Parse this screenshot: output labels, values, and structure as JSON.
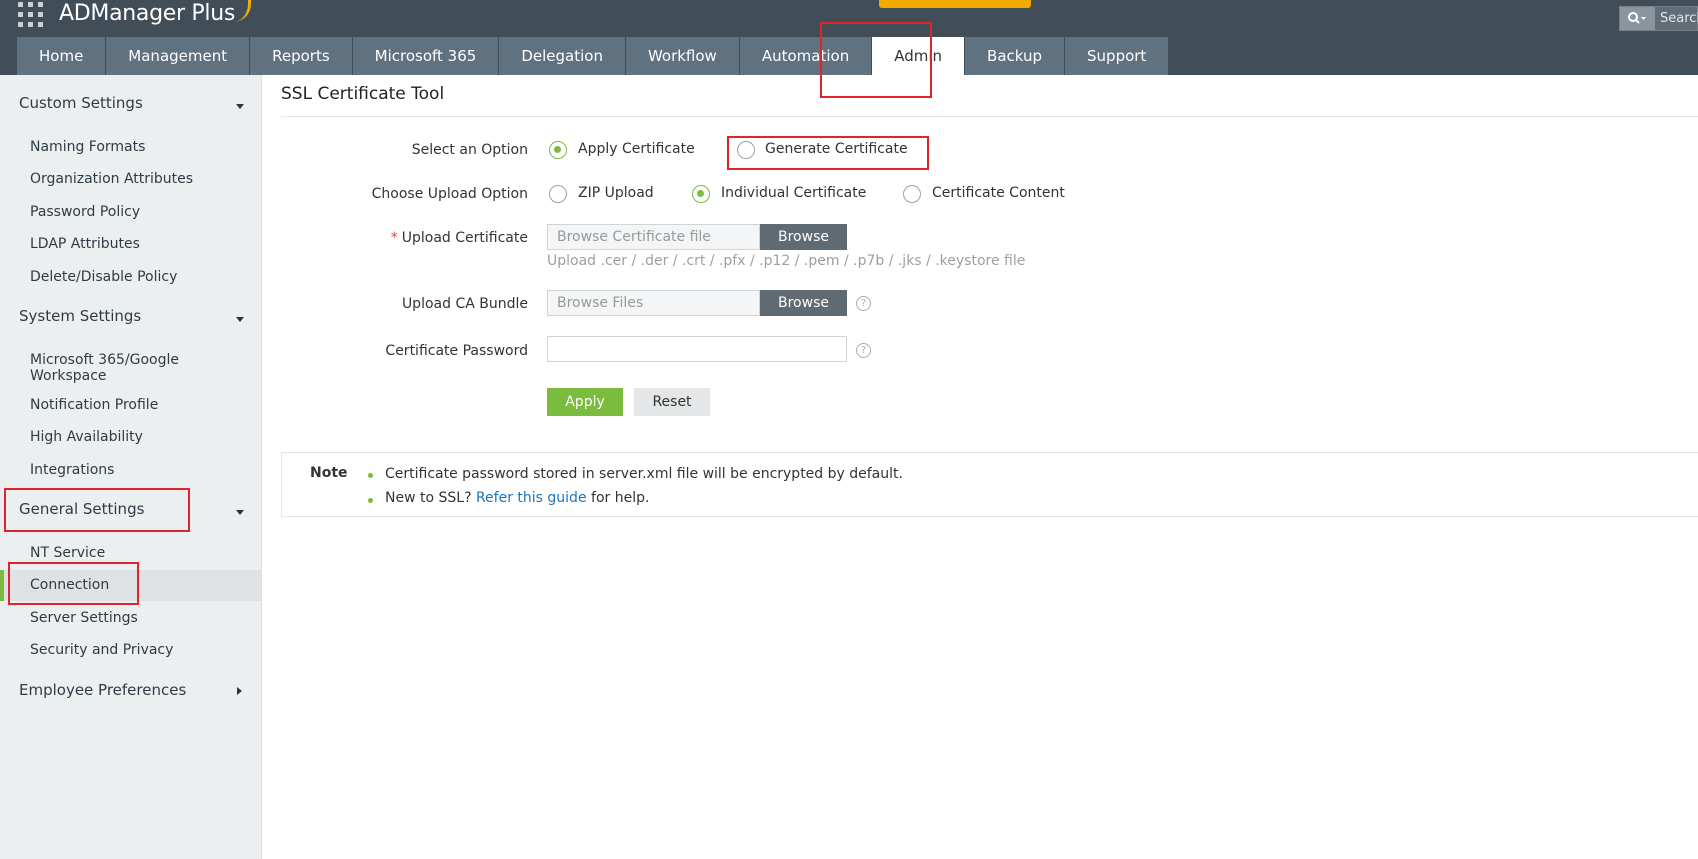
{
  "app": {
    "title": "ADManager Plus"
  },
  "search": {
    "placeholder": "Search"
  },
  "nav": {
    "tabs": [
      {
        "label": "Home"
      },
      {
        "label": "Management"
      },
      {
        "label": "Reports"
      },
      {
        "label": "Microsoft 365"
      },
      {
        "label": "Delegation"
      },
      {
        "label": "Workflow"
      },
      {
        "label": "Automation"
      },
      {
        "label": "Admin",
        "active": true
      },
      {
        "label": "Backup"
      },
      {
        "label": "Support"
      }
    ]
  },
  "sidebar": {
    "custom_settings": {
      "label": "Custom Settings",
      "items": [
        "Naming Formats",
        "Organization Attributes",
        "Password Policy",
        "LDAP Attributes",
        "Delete/Disable Policy"
      ]
    },
    "system_settings": {
      "label": "System Settings",
      "items": [
        "Microsoft 365/Google Workspace",
        "Notification Profile",
        "High Availability",
        "Integrations"
      ]
    },
    "general_settings": {
      "label": "General Settings",
      "items": [
        "NT Service",
        "Connection",
        "Server Settings",
        "Security and Privacy"
      ],
      "selected": "Connection"
    },
    "employee_preferences": {
      "label": "Employee Preferences"
    }
  },
  "page": {
    "title": "SSL Certificate Tool"
  },
  "form": {
    "select_option": {
      "label": "Select an Option",
      "options": [
        "Apply Certificate",
        "Generate Certificate"
      ],
      "selected": "Apply Certificate"
    },
    "upload_option": {
      "label": "Choose Upload Option",
      "options": [
        "ZIP Upload",
        "Individual Certificate",
        "Certificate Content"
      ],
      "selected": "Individual Certificate"
    },
    "upload_certificate": {
      "required_mark": "*",
      "label": "Upload Certificate",
      "placeholder": "Browse Certificate file",
      "browse_label": "Browse",
      "hint": "Upload .cer / .der / .crt / .pfx / .p12 / .pem / .p7b / .jks / .keystore file"
    },
    "ca_bundle": {
      "label": "Upload CA Bundle",
      "placeholder": "Browse Files",
      "browse_label": "Browse"
    },
    "certificate_password": {
      "label": "Certificate Password",
      "value": ""
    },
    "help_glyph": "?",
    "apply_label": "Apply",
    "reset_label": "Reset"
  },
  "note": {
    "title": "Note",
    "line1": "Certificate password stored in server.xml file will be encrypted by default.",
    "line2_before": "New to SSL?",
    "line2_link": "Refer this guide",
    "line2_after": "for help."
  },
  "colors": {
    "header_bg": "#414d57",
    "tab_bg": "#607180",
    "accent_green": "#7bbc3f",
    "browse_btn": "#5f6a72",
    "link_blue": "#1b75bb",
    "highlight_red": "#e0242b",
    "banner_orange": "#f2a900"
  }
}
